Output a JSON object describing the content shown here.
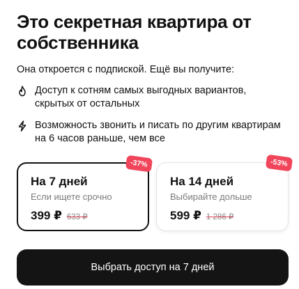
{
  "header": {
    "title": "Это секретная квартира от собственника",
    "subtitle": "Она откроется с подпиской. Ещё вы получите:"
  },
  "features": [
    {
      "icon": "fire-icon",
      "text": "Доступ к сотням самых выгодных вариантов, скрытых от остальных"
    },
    {
      "icon": "lightning-icon",
      "text": "Возможность звонить и писать по другим квартирам на 6 часов раньше, чем все"
    }
  ],
  "plans": [
    {
      "name": "На 7 дней",
      "hint": "Если ищете срочно",
      "price": "399 ₽",
      "old_price": "633 ₽",
      "discount": "-37%",
      "selected": true
    },
    {
      "name": "На 14 дней",
      "hint": "Выбирайте дольше",
      "price": "599 ₽",
      "old_price": "1 286 ₽",
      "discount": "-53%",
      "selected": false
    }
  ],
  "cta": {
    "label": "Выбрать доступ на 7 дней"
  },
  "colors": {
    "accent": "#141414",
    "badge": "#f0455a",
    "selected_border": "#111111"
  }
}
